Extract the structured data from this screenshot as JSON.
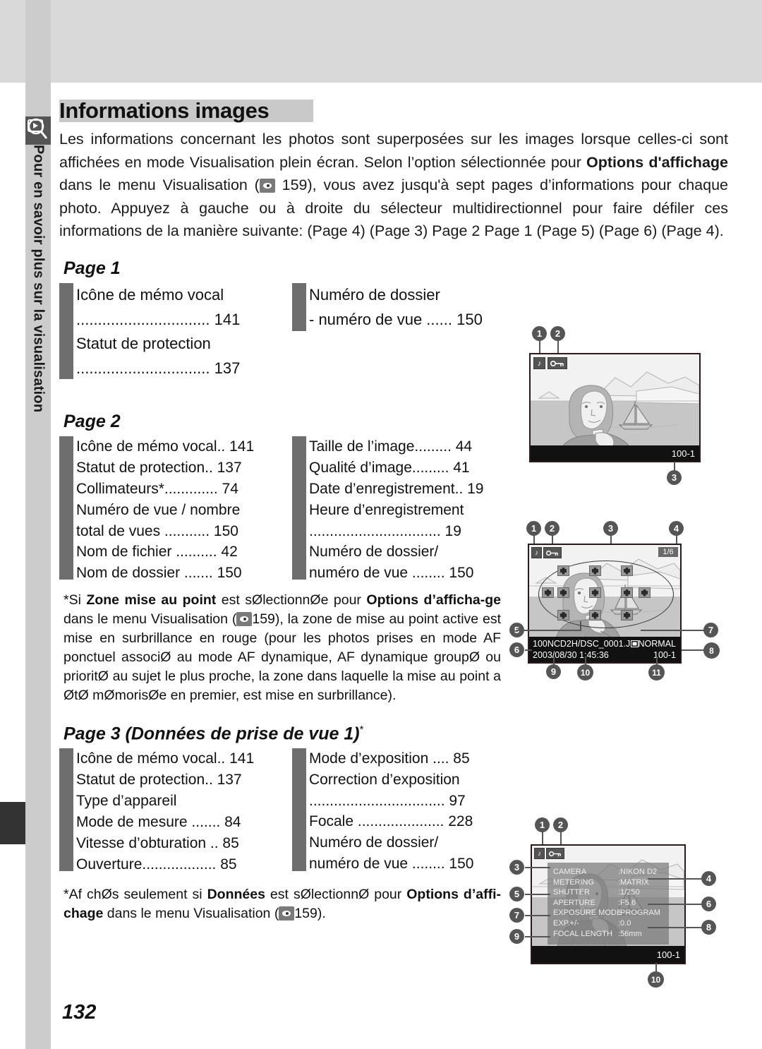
{
  "sidebar": {
    "tab_label": "Pour en savoir plus sur la visualisation",
    "icon": "playback-magnifier-icon"
  },
  "page_number": "132",
  "header": {
    "title": "Informations images"
  },
  "intro": {
    "part1": "Les informations concernant les photos sont superposées sur les images lorsque celles-ci sont affichées en mode Visualisation plein écran. Selon l’option sélectionnée pour ",
    "bold1": "Options d'affichage",
    "part2": " dans le menu Visualisation (",
    "ref_page": "159",
    "part3": "), vous avez jusqu'à sept pages d’informations pour chaque photo. Appuyez à gauche ou à droite du sélecteur multidirectionnel pour faire défiler ces informations de la manière suivante: (Page 4)    (Page 3)    Page 2    Page 1    (Page 5)    (Page 6)    (Page 4)."
  },
  "sections": [
    {
      "heading": "Page 1",
      "heading_sup": "",
      "left_items": [
        {
          "num": "1",
          "text": "Icône de mémo vocal"
        },
        {
          "num": "",
          "text": "............................... 141"
        },
        {
          "num": "2",
          "text": "Statut de protection"
        },
        {
          "num": "",
          "text": "............................... 137"
        }
      ],
      "right_items": [
        {
          "num": "3",
          "text": "Numéro de dossier"
        },
        {
          "num": "",
          "text": "- numéro de vue ...... 150"
        }
      ]
    },
    {
      "heading": "Page 2",
      "heading_sup": "",
      "left_items": [
        {
          "num": "1",
          "text": "Icône de mémo vocal.. 141"
        },
        {
          "num": "2",
          "text": "Statut de protection.. 137"
        },
        {
          "num": "3",
          "text": "Collimateurs*............. 74"
        },
        {
          "num": "4",
          "text": "Numéro de vue / nombre"
        },
        {
          "num": "",
          "text": "total de vues ........... 150"
        },
        {
          "num": "5",
          "text": "Nom de fichier .......... 42"
        },
        {
          "num": "6",
          "text": "Nom de dossier ....... 150"
        }
      ],
      "right_items": [
        {
          "num": "7",
          "text": "Taille de l’image......... 44"
        },
        {
          "num": "8",
          "text": "Qualité d’image......... 41"
        },
        {
          "num": "9",
          "text": "Date d’enregistrement.. 19"
        },
        {
          "num": "10",
          "text": "Heure d’enregistrement"
        },
        {
          "num": "",
          "text": "................................ 19"
        },
        {
          "num": "11",
          "text": "Numéro de dossier/"
        },
        {
          "num": "",
          "text": "numéro de vue ........ 150"
        }
      ]
    },
    {
      "heading": "Page 3 (Données de prise de vue 1)",
      "heading_sup": "*",
      "left_items": [
        {
          "num": "1",
          "text": "Icône de mémo vocal.. 141"
        },
        {
          "num": "2",
          "text": "Statut de protection.. 137"
        },
        {
          "num": "3",
          "text": "Type d’appareil"
        },
        {
          "num": "4",
          "text": "Mode de mesure ....... 84"
        },
        {
          "num": "5",
          "text": "Vitesse d’obturation .. 85"
        },
        {
          "num": "6",
          "text": "Ouverture.................. 85"
        }
      ],
      "right_items": [
        {
          "num": "7",
          "text": "Mode d’exposition .... 85"
        },
        {
          "num": "8",
          "text": "Correction d’exposition"
        },
        {
          "num": "",
          "text": "................................. 97"
        },
        {
          "num": "9",
          "text": "Focale ..................... 228"
        },
        {
          "num": "10",
          "text": "Numéro de dossier/"
        },
        {
          "num": "",
          "text": "numéro de vue ........ 150"
        }
      ]
    }
  ],
  "footnote_page2": {
    "star": "*",
    "t1": "Si ",
    "b1": "Zone mise au point",
    "t2": " est sØlectionnØe pour ",
    "b2": "Options d’afficha-",
    "b3": "ge",
    "t3": " dans le menu Visualisation (",
    "ref": "159",
    "t4": "), la zone de mise au point active est mise en surbrillance en rouge (pour les photos prises en mode AF ponctuel associØ au mode AF dynamique, AF dynamique groupØ ou prioritØ au sujet le plus proche, la zone dans laquelle la mise au point a ØtØ mØmorisØe en premier, est mise en surbrillance)."
  },
  "footnote_page3": {
    "star": "*",
    "t1": "Af chØs seulement si ",
    "b1": "Données",
    "t2": " est sØlectionnØ pour ",
    "b2": "Options d’affi-",
    "b3": "chage",
    "t3": " dans le menu Visualisation (",
    "ref": "159",
    "t4": ")."
  },
  "lcd_page1": {
    "icons": [
      "voice-memo-note-icon",
      "protect-key-icon"
    ],
    "callouts": [
      "1",
      "2",
      "3"
    ],
    "frame_number": "100-1"
  },
  "lcd_page2": {
    "icons": [
      "voice-memo-note-icon",
      "protect-key-icon"
    ],
    "frame_counter": "1/6",
    "filename": "100NCD2H/DSC_0001.J",
    "datetime": "2003/08/30  1:45:36",
    "quality": "NORMAL",
    "frame_number": "100-1",
    "callouts": [
      "1",
      "2",
      "3",
      "4",
      "5",
      "6",
      "7",
      "8",
      "9",
      "10",
      "11"
    ]
  },
  "lcd_page3": {
    "icons": [
      "voice-memo-note-icon",
      "protect-key-icon"
    ],
    "rows": [
      {
        "key": "CAMERA",
        "value": ":NIKON D2"
      },
      {
        "key": "METERING",
        "value": ":MATRIX"
      },
      {
        "key": "SHUTTER",
        "value": ":1/250"
      },
      {
        "key": "APERTURE",
        "value": ":F5.6"
      },
      {
        "key": "EXPOSURE MODE",
        "value": ":PROGRAM"
      },
      {
        "key": "EXP.+/-",
        "value": ":0.0"
      },
      {
        "key": "FOCAL LENGTH",
        "value": ":56mm"
      }
    ],
    "frame_number": "100-1",
    "callouts": [
      "1",
      "2",
      "3",
      "4",
      "5",
      "6",
      "7",
      "8",
      "9",
      "10"
    ]
  },
  "colors": {
    "band_gray": "#d9d9d9",
    "side_gray": "#cccccc",
    "bullet_gray": "#6e6e6e",
    "title_highlight": "#c9c9c9",
    "lcd_strip": "#111111"
  }
}
